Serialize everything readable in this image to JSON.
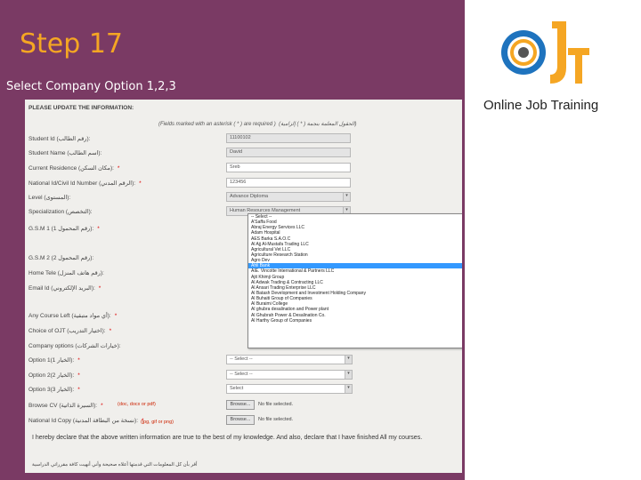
{
  "slide": {
    "title": "Step 17",
    "subtitle": "Select Company Option 1,2,3",
    "logo_text": "Online Job Training"
  },
  "form": {
    "header": "PLEASE UPDATE THE INFORMATION:",
    "note": "(Fields marked with an asterisk ( * ) are required )",
    "note_ar": "(الحقول المعلمة بنجمة ( * ) إلزامية)",
    "fields": [
      {
        "label": "Student Id (رقم الطالب):",
        "value": "11100102",
        "required": false
      },
      {
        "label": "Student Name (اسم الطالب):",
        "value": "David",
        "required": false
      },
      {
        "label": "Current Residence (مكان السكن):",
        "value": "Sreb",
        "required": true
      },
      {
        "label": "National Id/Civil Id Number (الرقم المدني):",
        "value": "123456",
        "required": true
      },
      {
        "label": "Level (المستوى):",
        "value": "Advance Diploma",
        "required": false
      },
      {
        "label": "Specialization (التخصص):",
        "value": "Human Resources Management",
        "required": false
      },
      {
        "label": "G.S.M 1 (رقم المحمول 1):",
        "value": "",
        "required": true
      },
      {
        "label": "G.S.M 2 (رقم المحمول 2):",
        "value": "",
        "required": false
      },
      {
        "label": "Home Tele (رقم هاتف المنزل):",
        "value": "",
        "required": false
      },
      {
        "label": "Email Id (البريد الإلكتروني):",
        "value": "",
        "required": true
      },
      {
        "label": "Any Course Left (أي مواد متبقية):",
        "value": "",
        "required": true
      },
      {
        "label": "Choice of OJT (اختيار التدريب):",
        "value": "",
        "required": true
      },
      {
        "label": "Company options (خيارات الشركات):",
        "value": "",
        "required": false
      },
      {
        "label": "Option 1(1 الخيار):",
        "value": "-- Select --",
        "required": true
      },
      {
        "label": "Option 2(2 الخيار):",
        "value": "-- Select --",
        "required": true
      },
      {
        "label": "Option 3(3 الخيار):",
        "value": "Select",
        "required": true
      }
    ],
    "cv": {
      "label": "Browse CV (السيرة الذاتية):",
      "hint": "(doc, docx or pdf)",
      "button": "Browse...",
      "status": "No file selected."
    },
    "idcopy": {
      "label": "National Id Copy (نسخة من البطاقة المدنية):",
      "hint": "(jpg, gif or png)",
      "button": "Browse...",
      "status": "No file selected."
    },
    "declaration": "I hereby declare that the above written information are true to the best of my knowledge. And also, declare that I have finished All my courses.",
    "declaration_ar": "أقر بأن كل المعلومات التي قدمتها أعلاه صحيحة وأني أنهيت كافة مقرراتي الدراسية"
  },
  "dropdown": {
    "selected_index": 9,
    "options": [
      "-- Select --",
      "A'Saffa Food",
      "Abraj Energy Services LLC",
      "Adam Hospital",
      "AES Barka S.A.O.C",
      "Al Ajj Al-Mustafa Trading LLC",
      "Agricultural Vet LLC",
      "Agriculture Research Station",
      "Agro Dev",
      "Ahli Bank",
      "AIE. Vincotte International & Partners LLC",
      "Ajit Khimji Group",
      "Al Adwak Trading & Contracting LLC",
      "Al Ansari Trading Enterprise LLC",
      "Al Batash Development and Investment Holding Company",
      "Al Buhaiti Group of Companies",
      "Al Buraimi College",
      "Al ghubra desalination and Power plant",
      "Al Ghubrah Power & Desalination Co.",
      "Al Harthy Group of Companies"
    ]
  }
}
